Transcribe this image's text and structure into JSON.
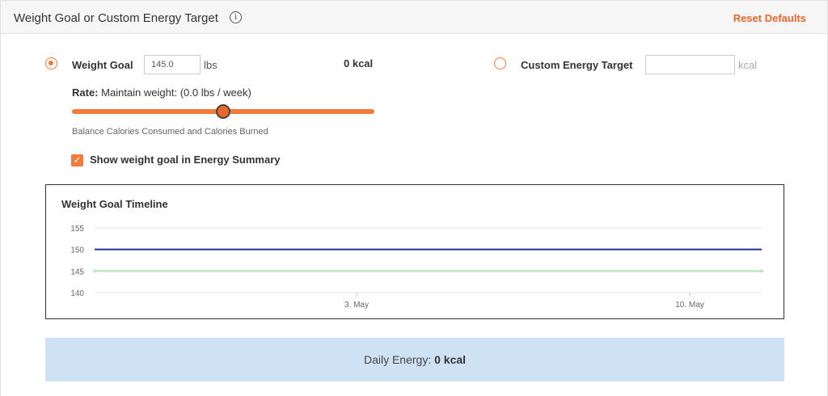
{
  "header": {
    "title": "Weight Goal or Custom Energy Target",
    "info_icon": "i",
    "reset_label": "Reset Defaults"
  },
  "weight_goal": {
    "label": "Weight Goal",
    "selected": true,
    "value": "145.0",
    "unit": "lbs",
    "kcal": "0 kcal"
  },
  "custom_target": {
    "label": "Custom Energy Target",
    "selected": false,
    "value": "",
    "unit": "kcal"
  },
  "rate": {
    "label": "Rate:",
    "text": "Maintain weight: (0.0 lbs / week)",
    "slider_fraction": 0.5
  },
  "balance_text": "Balance Calories Consumed and Calories Burned",
  "show_in_summary": {
    "checked": true,
    "label": "Show weight goal in Energy Summary"
  },
  "chart_data": {
    "type": "line",
    "title": "Weight Goal Timeline",
    "yticks": [
      155,
      150,
      145,
      140
    ],
    "ylim": [
      140,
      155
    ],
    "xticks": [
      "3. May",
      "10. May"
    ],
    "series": [
      {
        "color": "#1f2f99",
        "values": [
          150,
          150
        ]
      },
      {
        "color": "#bfe6bf",
        "values": [
          145,
          145
        ]
      }
    ],
    "grid": true
  },
  "daily_energy": {
    "label": "Daily Energy:",
    "value": "0 kcal"
  },
  "colors": {
    "accent": "#e8672b",
    "energy_bar": "#cfe2f3"
  }
}
